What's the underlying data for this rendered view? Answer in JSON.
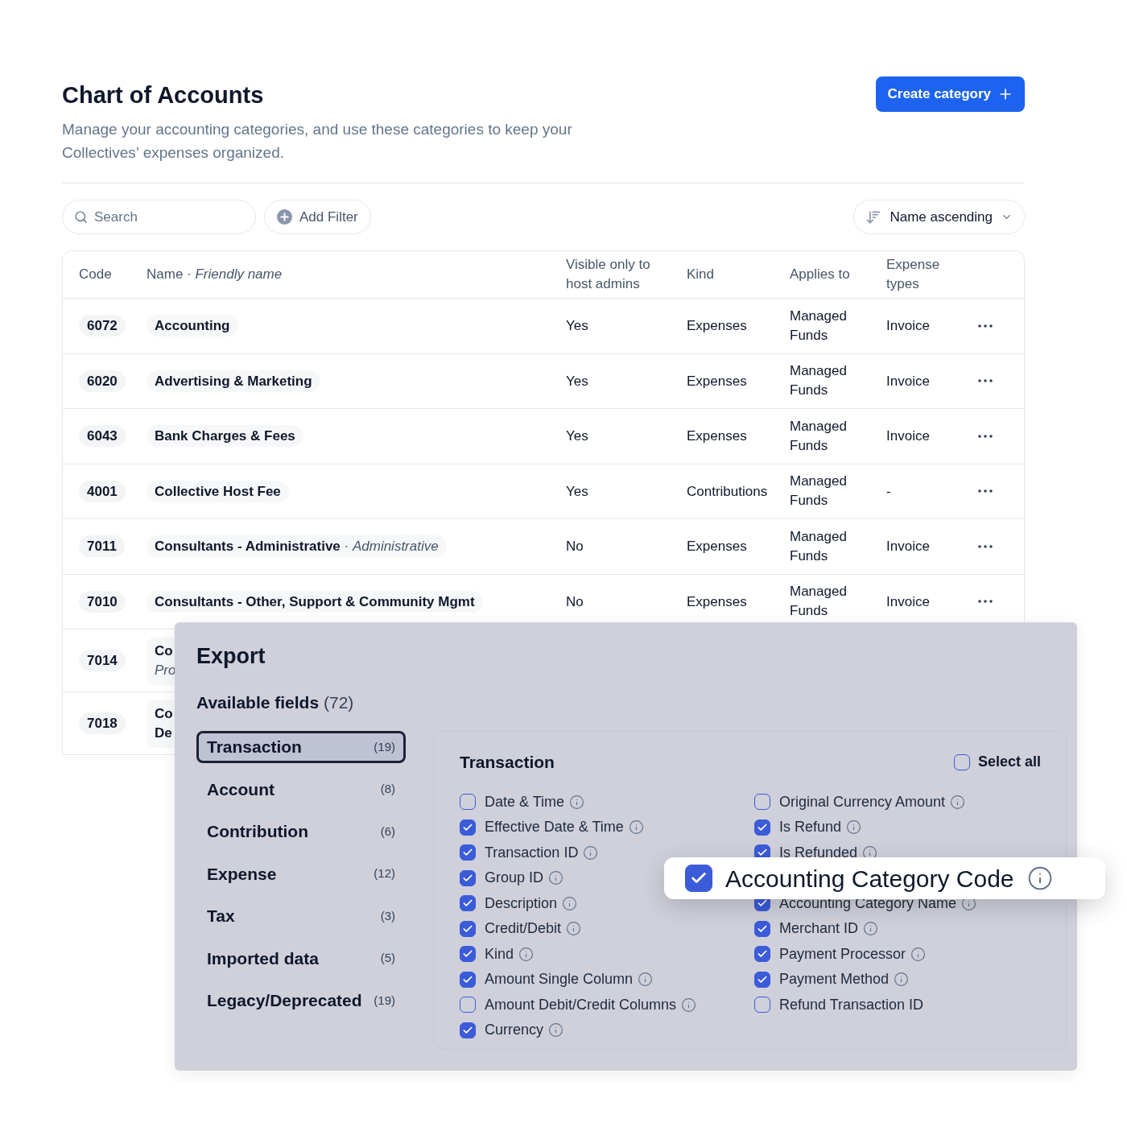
{
  "header": {
    "title": "Chart of Accounts",
    "description": "Manage your accounting categories, and use these categories to keep your Collectives’ expenses organized.",
    "create_button": "Create category"
  },
  "toolbar": {
    "search_placeholder": "Search",
    "filter_button": "Add Filter",
    "sort": "Name ascending"
  },
  "table": {
    "columns": [
      "Code",
      "Name · *Friendly name*",
      "Visible only to host admins",
      "Kind",
      "Applies to",
      "Expense types"
    ],
    "rows": [
      {
        "kind": "full",
        "code": "6072",
        "name": "Accounting",
        "visible": "Yes",
        "type": "Expenses",
        "applies_to": "Managed Funds",
        "expense_types": "Invoice"
      },
      {
        "kind": "full",
        "code": "6020",
        "name": "Advertising & Marketing",
        "visible": "Yes",
        "type": "Expenses",
        "applies_to": "Managed Funds",
        "expense_types": "Invoice"
      },
      {
        "kind": "full",
        "code": "6043",
        "name": "Bank Charges & Fees",
        "visible": "Yes",
        "type": "Expenses",
        "applies_to": "Managed Funds",
        "expense_types": "Invoice"
      },
      {
        "kind": "full",
        "code": "4001",
        "name": "Collective Host Fee",
        "visible": "Yes",
        "type": "Contributions",
        "applies_to": "Managed Funds",
        "expense_types": "-"
      },
      {
        "kind": "full",
        "code": "7011",
        "name": "Consultants - Administrative",
        "separator": "·",
        "friendly_name": "Administrative",
        "visible": "No",
        "type": "Expenses",
        "applies_to": "Managed Funds",
        "expense_types": "Invoice"
      },
      {
        "kind": "full",
        "code": "7010",
        "name": "Consultants - Other, Support & Community Mgmt",
        "visible": "No",
        "type": "Expenses",
        "applies_to": "Managed Funds",
        "expense_types": "Invoice"
      },
      {
        "kind": "covered",
        "code": "7014",
        "name_lines": [
          {
            "text": "Co",
            "italic": false
          },
          {
            "text": "Pro",
            "italic": true
          }
        ]
      },
      {
        "kind": "covered",
        "code": "7018",
        "name_lines": [
          {
            "text": "Co",
            "italic": false
          },
          {
            "text": "De",
            "italic": false
          }
        ]
      }
    ]
  },
  "export": {
    "title": "Export",
    "available_label": "Available fields",
    "available_count": "(72)",
    "groups": [
      {
        "label": "Transaction",
        "count": "(19)",
        "selected": true
      },
      {
        "label": "Account",
        "count": "(8)",
        "selected": false
      },
      {
        "label": "Contribution",
        "count": "(6)",
        "selected": false
      },
      {
        "label": "Expense",
        "count": "(12)",
        "selected": false
      },
      {
        "label": "Tax",
        "count": "(3)",
        "selected": false
      },
      {
        "label": "Imported data",
        "count": "(5)",
        "selected": false
      },
      {
        "label": "Legacy/Deprecated",
        "count": "(19)",
        "selected": false
      }
    ],
    "panel": {
      "title": "Transaction",
      "select_all": {
        "label": "Select all",
        "checked": false
      },
      "left_fields": [
        {
          "kind": "field",
          "label": "Date & Time",
          "checked": false,
          "info": true
        },
        {
          "kind": "field",
          "label": "Effective Date & Time",
          "checked": true,
          "info": true
        },
        {
          "kind": "field",
          "label": "Transaction ID",
          "checked": true,
          "info": true
        },
        {
          "kind": "field",
          "label": "Group ID",
          "checked": true,
          "info": true
        },
        {
          "kind": "field",
          "label": "Description",
          "checked": true,
          "info": true
        },
        {
          "kind": "field",
          "label": "Credit/Debit",
          "checked": true,
          "info": true
        },
        {
          "kind": "field",
          "label": "Kind",
          "checked": true,
          "info": true
        },
        {
          "kind": "field",
          "label": "Amount Single Column",
          "checked": true,
          "info": true
        },
        {
          "kind": "field",
          "label": "Amount Debit/Credit Columns",
          "checked": false,
          "info": true
        },
        {
          "kind": "field",
          "label": "Currency",
          "checked": true,
          "info": true
        }
      ],
      "right_fields": [
        {
          "kind": "field",
          "label": "Original Currency Amount",
          "checked": false,
          "info": true
        },
        {
          "kind": "field",
          "label": "Is Refund",
          "checked": true,
          "info": true
        },
        {
          "kind": "field",
          "label": "Is Refunded",
          "checked": true,
          "info": true
        },
        {
          "kind": "zoomed",
          "label": "Accounting Category Code",
          "checked": true,
          "info": true
        },
        {
          "kind": "field",
          "label": "Accounting Category Name",
          "checked": true,
          "info": true
        },
        {
          "kind": "field",
          "label": "Merchant ID",
          "checked": true,
          "info": true
        },
        {
          "kind": "field",
          "label": "Payment Processor",
          "checked": true,
          "info": true
        },
        {
          "kind": "field",
          "label": "Payment Method",
          "checked": true,
          "info": true
        },
        {
          "kind": "field",
          "label": "Refund Transaction ID",
          "checked": false,
          "info": false
        }
      ]
    }
  }
}
